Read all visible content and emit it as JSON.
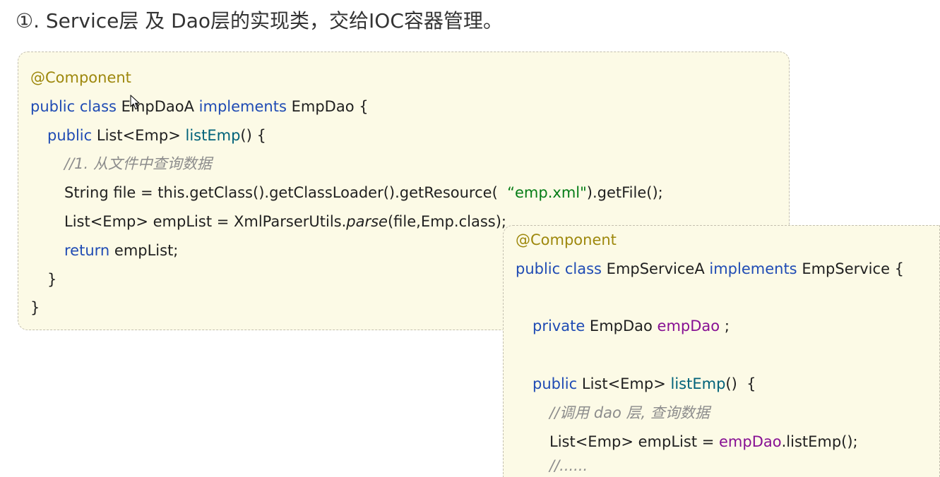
{
  "heading": "①. Service层 及 Dao层的实现类，交给IOC容器管理。",
  "dao_code": {
    "lines": [
      [
        "@Component"
      ],
      [
        "public class",
        " EmpDaoA ",
        "implements",
        " EmpDao {"
      ],
      [
        "public",
        " List<Emp> ",
        "listEmp",
        "() {"
      ],
      [
        "//1. 从文件中查询数据"
      ],
      [
        "String file = this.getClass().getClassLoader().getResource(  ",
        "“emp.xml\"",
        ").getFile();"
      ],
      [
        "List<Emp> empList = XmlParserUtils.",
        "parse",
        "(file,Emp.class);"
      ],
      [
        "return",
        " empList;"
      ],
      [
        "}"
      ],
      [
        "}"
      ]
    ]
  },
  "service_code": {
    "lines": [
      [
        "@Component"
      ],
      [
        "public class",
        " EmpServiceA ",
        "implements",
        " EmpService {"
      ],
      [],
      [
        "private",
        " EmpDao ",
        "empDao",
        " ;"
      ],
      [],
      [
        "public",
        " List<Emp> ",
        "listEmp",
        "()  {"
      ],
      [
        "//调用 dao 层, 查询数据"
      ],
      [
        "List<Emp> empList = ",
        "empDao",
        ".listEmp();"
      ],
      [
        "//......"
      ]
    ]
  },
  "icons": {
    "cursor": "mouse-pointer-icon"
  },
  "colors": {
    "page_background": "#ffffff",
    "heading_text": "#333333",
    "box_background": "#fcfae6",
    "box_border": "#c4c0b0",
    "code_text": "#1f1f1f",
    "keyword": "#1f4bb4",
    "annotation": "#9e880d",
    "method": "#00627a",
    "field": "#871094",
    "string": "#067d17",
    "comment": "#8c8c8c"
  }
}
